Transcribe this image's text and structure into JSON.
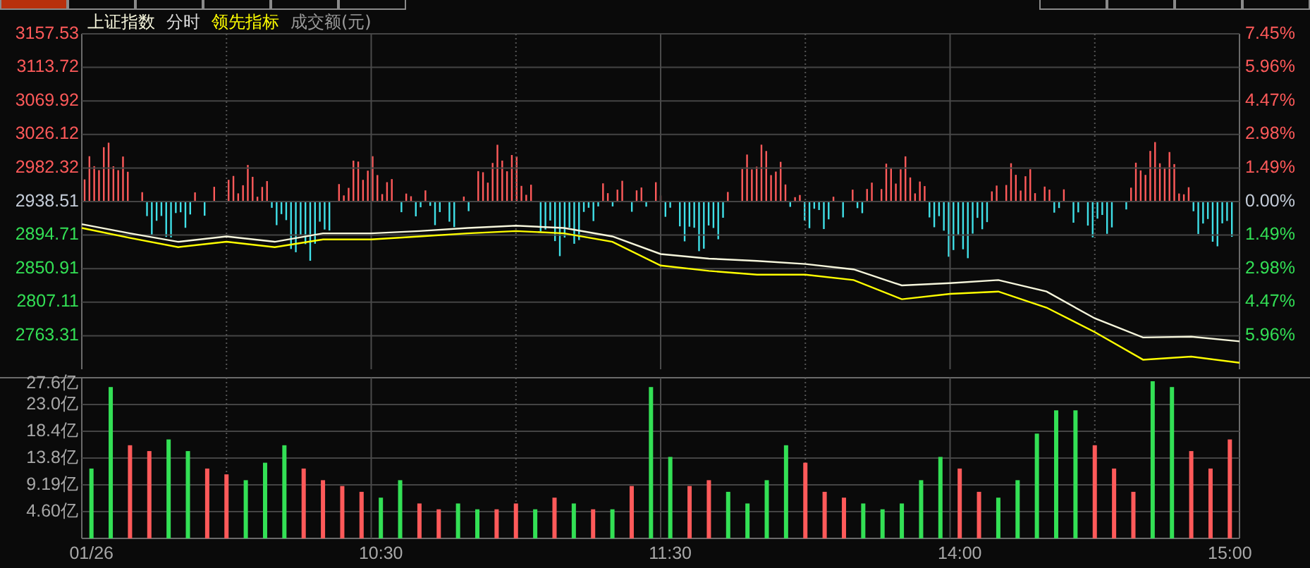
{
  "top_tabs": [
    {
      "selected": true
    },
    {
      "selected": false
    },
    {
      "selected": false
    },
    {
      "selected": false
    },
    {
      "selected": false
    },
    {
      "selected": false
    },
    {
      "selected": false
    },
    {
      "selected": false
    },
    {
      "selected": false
    },
    {
      "selected": false
    }
  ],
  "mode_label": "分时",
  "amount_label": "成交额(元)",
  "price_chart": {
    "chart_data": {
      "type": "line",
      "categories": [
        null,
        null,
        null,
        null,
        null,
        null,
        null,
        null,
        null,
        null,
        null,
        null,
        null,
        null,
        null,
        null,
        null,
        null,
        null,
        null,
        null,
        null,
        null,
        null,
        null
      ],
      "ylim": [
        2719.5,
        3157.53
      ],
      "grid": true,
      "yticks": [
        {
          "value": 3157.53,
          "label": "3157.53"
        },
        {
          "value": 3113.72,
          "label": "3113.72"
        },
        {
          "value": 3069.92,
          "label": "3069.92"
        },
        {
          "value": 3026.12,
          "label": "3026.12"
        },
        {
          "value": 2982.32,
          "label": "2982.32"
        },
        {
          "value": 2938.51,
          "label": "2938.51"
        },
        {
          "value": 2894.71,
          "label": "2894.71"
        },
        {
          "value": 2850.91,
          "label": "2850.91"
        },
        {
          "value": 2807.11,
          "label": "2807.11"
        },
        {
          "value": 2763.31,
          "label": "2763.31"
        }
      ],
      "series": [
        {
          "name": "上证指数",
          "color": "#f6f6dc",
          "values": [
            2909,
            2897,
            2886,
            2893,
            2886,
            2897,
            2897,
            2900,
            2904,
            2907,
            2904,
            2893,
            2870,
            2864,
            2861,
            2857,
            2850,
            2829,
            2832,
            2836,
            2821,
            2786,
            2761,
            2762,
            2756
          ]
        },
        {
          "name": "领先指标",
          "color": "#ffff00",
          "values": [
            2904,
            2891,
            2879,
            2886,
            2879,
            2889,
            2889,
            2893,
            2897,
            2900,
            2897,
            2886,
            2855,
            2848,
            2843,
            2843,
            2836,
            2811,
            2818,
            2821,
            2800,
            2768,
            2732,
            2736,
            2728
          ]
        }
      ]
    },
    "right_axis": [
      "7.45%",
      "5.96%",
      "4.47%",
      "2.98%",
      "1.49%",
      "0.00%",
      "1.49%",
      "2.98%",
      "4.47%",
      "5.96%"
    ]
  },
  "volume_chart": {
    "chart_data": {
      "type": "bar",
      "stacked": true,
      "grid": true,
      "ylim": [
        0,
        27.6
      ],
      "yticks": [
        {
          "value": 27.6,
          "label": "27.6亿"
        },
        {
          "value": 23.0,
          "label": "23.0亿"
        },
        {
          "value": 18.4,
          "label": "18.4亿"
        },
        {
          "value": 13.8,
          "label": "13.8亿"
        },
        {
          "value": 9.19,
          "label": "9.19亿"
        },
        {
          "value": 4.6,
          "label": "4.60亿"
        }
      ],
      "categories": [
        "01/26",
        null,
        null,
        null,
        null,
        null,
        null,
        null,
        null,
        null,
        null,
        null,
        null,
        null,
        null,
        "10:30",
        null,
        null,
        null,
        null,
        null,
        null,
        null,
        null,
        null,
        null,
        null,
        null,
        null,
        null,
        "11:30",
        null,
        null,
        null,
        null,
        null,
        null,
        null,
        null,
        null,
        null,
        null,
        null,
        null,
        null,
        "14:00",
        null,
        null,
        null,
        null,
        null,
        null,
        null,
        null,
        null,
        null,
        null,
        null,
        null,
        "15:00"
      ],
      "series": [
        {
          "color": "#ff5a5a",
          "values": [
            null,
            null,
            16,
            15,
            null,
            null,
            12,
            11,
            null,
            null,
            null,
            12,
            10,
            9,
            8,
            null,
            null,
            6,
            5,
            null,
            null,
            5,
            6,
            null,
            7,
            null,
            5,
            null,
            9,
            null,
            null,
            9,
            10,
            null,
            null,
            null,
            null,
            13,
            8,
            7,
            null,
            null,
            null,
            null,
            null,
            12,
            8,
            null,
            null,
            null,
            null,
            null,
            16,
            12,
            8,
            null,
            null,
            15,
            12,
            17
          ]
        },
        {
          "color": "#33e055",
          "values": [
            12,
            26,
            null,
            null,
            17,
            15,
            null,
            null,
            10,
            13,
            16,
            null,
            null,
            null,
            null,
            7,
            10,
            null,
            null,
            6,
            5,
            null,
            null,
            5,
            null,
            6,
            null,
            5,
            null,
            26,
            14,
            null,
            null,
            8,
            6,
            10,
            16,
            null,
            null,
            null,
            6,
            5,
            6,
            10,
            14,
            null,
            null,
            7,
            10,
            18,
            22,
            22,
            null,
            null,
            null,
            27,
            26,
            null,
            null,
            null
          ]
        }
      ]
    }
  }
}
